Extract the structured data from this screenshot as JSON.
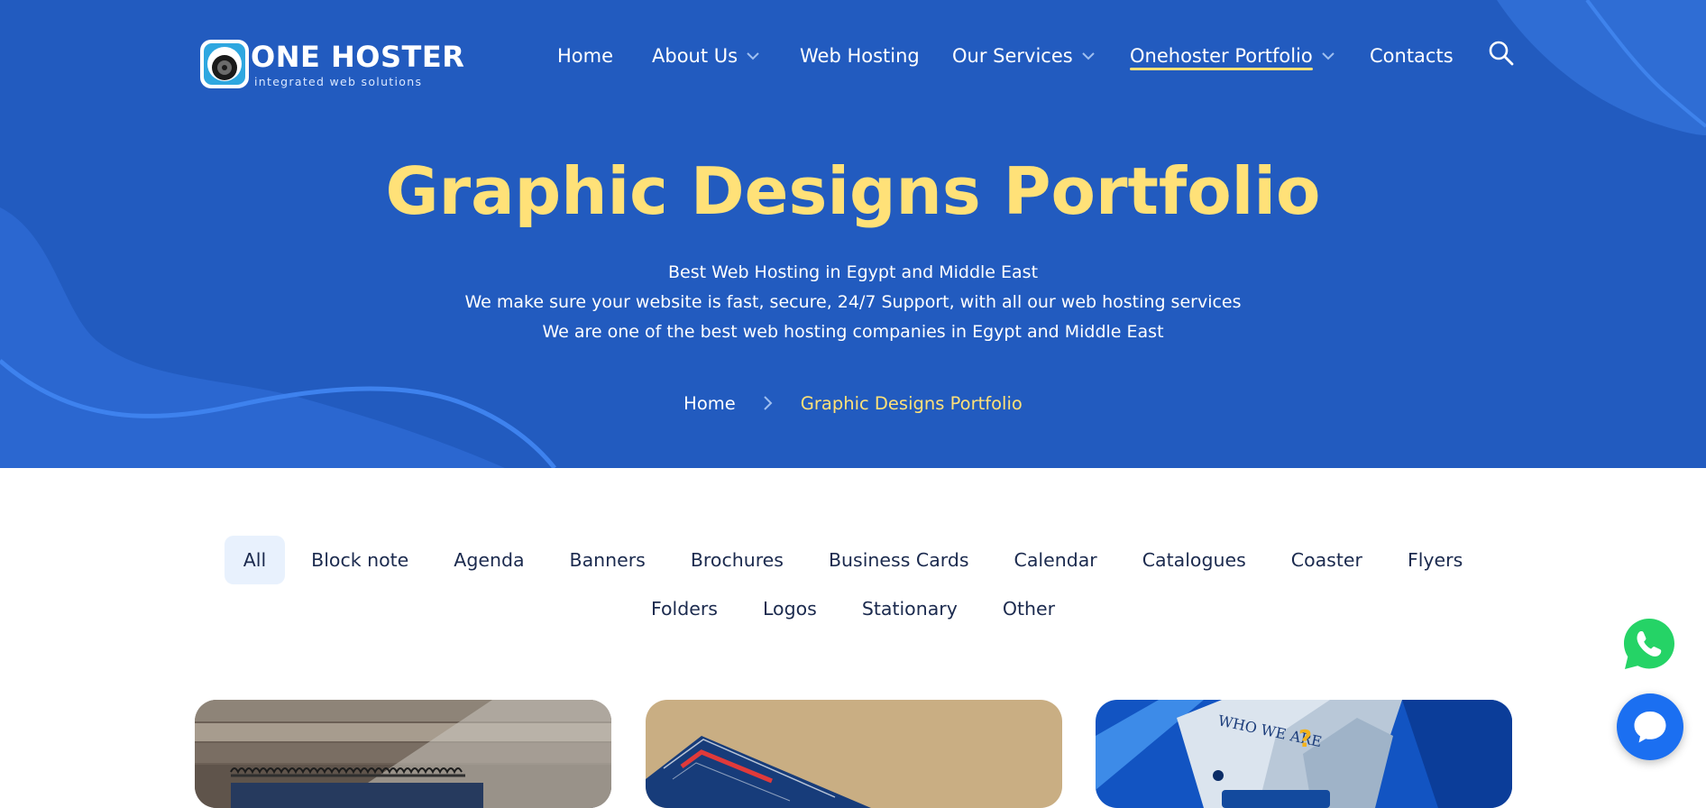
{
  "header": {
    "logo": {
      "brand": "ONE HOSTER",
      "tagline": "integrated web solutions"
    },
    "nav": [
      {
        "label": "Home",
        "dropdown": false
      },
      {
        "label": "About Us",
        "dropdown": true
      },
      {
        "label": "Web Hosting",
        "dropdown": false
      },
      {
        "label": "Our Services",
        "dropdown": true
      },
      {
        "label": "Onehoster Portfolio",
        "dropdown": true,
        "active": true
      },
      {
        "label": "Contacts",
        "dropdown": false
      }
    ],
    "search_icon": "search-icon"
  },
  "hero": {
    "title": "Graphic Designs Portfolio",
    "lines": [
      "Best Web Hosting in Egypt and Middle East",
      "We make sure your website is fast, secure, 24/7 Support, with all our web hosting services",
      "We are one of the best web hosting companies in Egypt and Middle East"
    ],
    "breadcrumb": {
      "home": "Home",
      "current": "Graphic Designs Portfolio"
    }
  },
  "filters": {
    "active": "All",
    "row1": [
      "All",
      "Block note",
      "Agenda",
      "Banners",
      "Brochures",
      "Business Cards",
      "Calendar",
      "Catalogues",
      "Coaster",
      "Flyers"
    ],
    "row2": [
      "Folders",
      "Logos",
      "Stationary",
      "Other"
    ]
  },
  "portfolio_cards": [
    {
      "description": "spiral-bound block note on wood"
    },
    {
      "description": "brochure on kraft background"
    },
    {
      "description": "blue brochure - who we are"
    }
  ],
  "card_overlay_text": "WHO WE ARE",
  "floating": {
    "whatsapp_icon": "whatsapp-icon",
    "chat_icon": "chat-icon"
  },
  "colors": {
    "hero_bg": "#225bbf",
    "accent_yellow": "#ffe178",
    "filter_active_bg": "#e8f1fd",
    "text_dark": "#1b2a4e",
    "whatsapp_green": "#25d366",
    "chat_blue": "#1b6ff1"
  }
}
